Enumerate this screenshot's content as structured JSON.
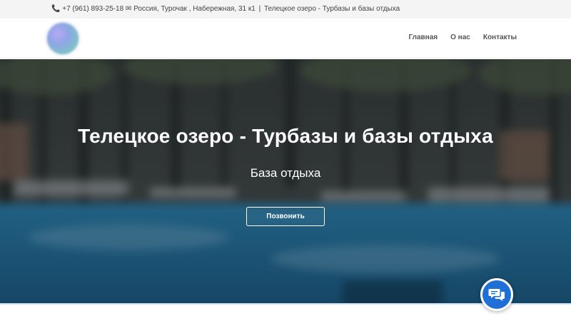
{
  "topbar": {
    "phone_icon": "phone-icon",
    "phone": "+7 (961) 893-25-18",
    "mail_icon": "envelope-icon",
    "address": "Россия, Турочак , Набережная, 31 к1",
    "separator": "|",
    "site_name": "Телецкое озеро - Турбазы и базы отдыха"
  },
  "navbar": {
    "logo": "site-logo",
    "items": [
      {
        "label": "Главная"
      },
      {
        "label": "О нас"
      },
      {
        "label": "Контакты"
      }
    ]
  },
  "hero": {
    "title": "Телецкое озеро - Турбазы и базы отдыха",
    "subtitle": "База отдыха",
    "call_button": "Позвонить"
  },
  "chat": {
    "icon": "chat-bubbles-icon",
    "color": "#1f6fd6"
  }
}
